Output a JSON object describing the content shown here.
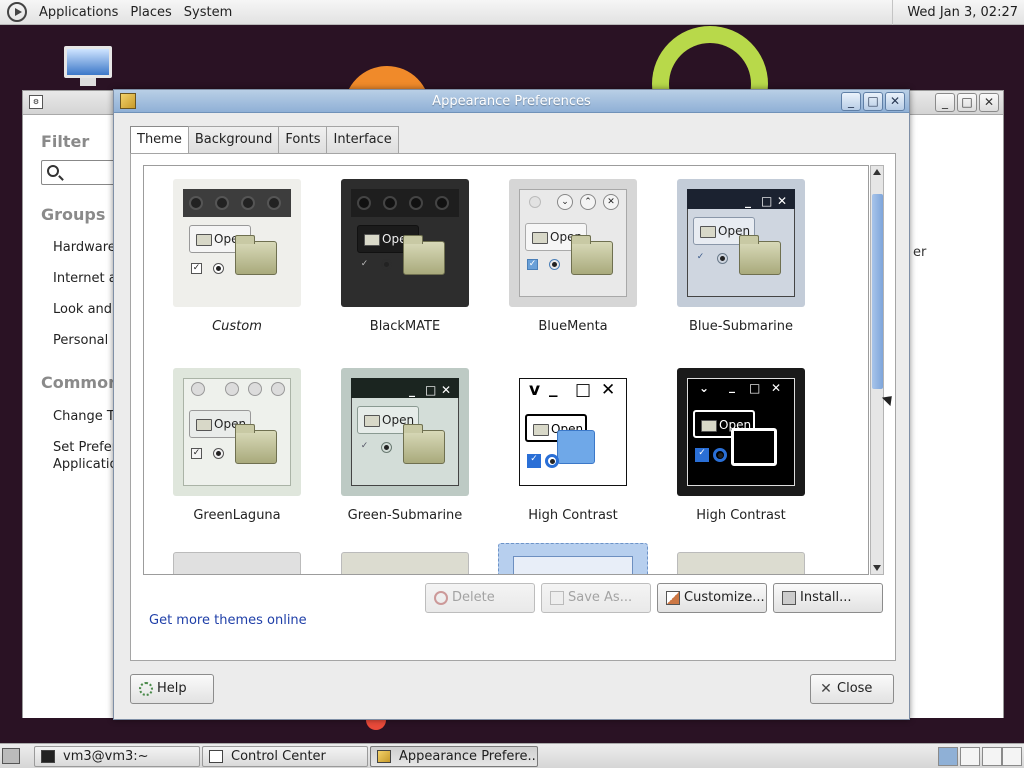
{
  "top_panel": {
    "menus": [
      "Applications",
      "Places",
      "System"
    ],
    "clock": "Wed Jan  3, 02:27"
  },
  "control_center": {
    "filter_heading": "Filter",
    "groups_heading": "Groups",
    "groups": [
      "Hardware",
      "Internet ar",
      "Look and F",
      "Personal"
    ],
    "common_heading": "Common T",
    "common_items": [
      "Change Th",
      "Set Prefere",
      "Applicatio"
    ],
    "right_text": "er"
  },
  "appearance": {
    "title": "Appearance Preferences",
    "tabs": [
      "Theme",
      "Background",
      "Fonts",
      "Interface"
    ],
    "active_tab": "Theme",
    "themes": [
      {
        "name": "Custom",
        "italic": true
      },
      {
        "name": "BlackMATE",
        "italic": false
      },
      {
        "name": "BlueMenta",
        "italic": false
      },
      {
        "name": "Blue-Submarine",
        "italic": false
      },
      {
        "name": "GreenLaguna",
        "italic": false
      },
      {
        "name": "Green-Submarine",
        "italic": false
      },
      {
        "name": "High Contrast",
        "italic": false
      },
      {
        "name": "High Contrast",
        "italic": false
      }
    ],
    "thumb_open_label": "Open",
    "buttons": {
      "delete": "Delete",
      "save_as": "Save As...",
      "customize": "Customize...",
      "install": "Install..."
    },
    "get_more_link": "Get more themes online",
    "help": "Help",
    "close": "Close"
  },
  "taskbar": {
    "tasks": [
      "vm3@vm3:~",
      "Control Center",
      "Appearance Prefere..."
    ],
    "active_task": "Appearance Prefere..."
  },
  "colors": {
    "titlebar_active": "#8fb0d6",
    "link": "#1f3fa8",
    "selection": "#7ea5da"
  }
}
